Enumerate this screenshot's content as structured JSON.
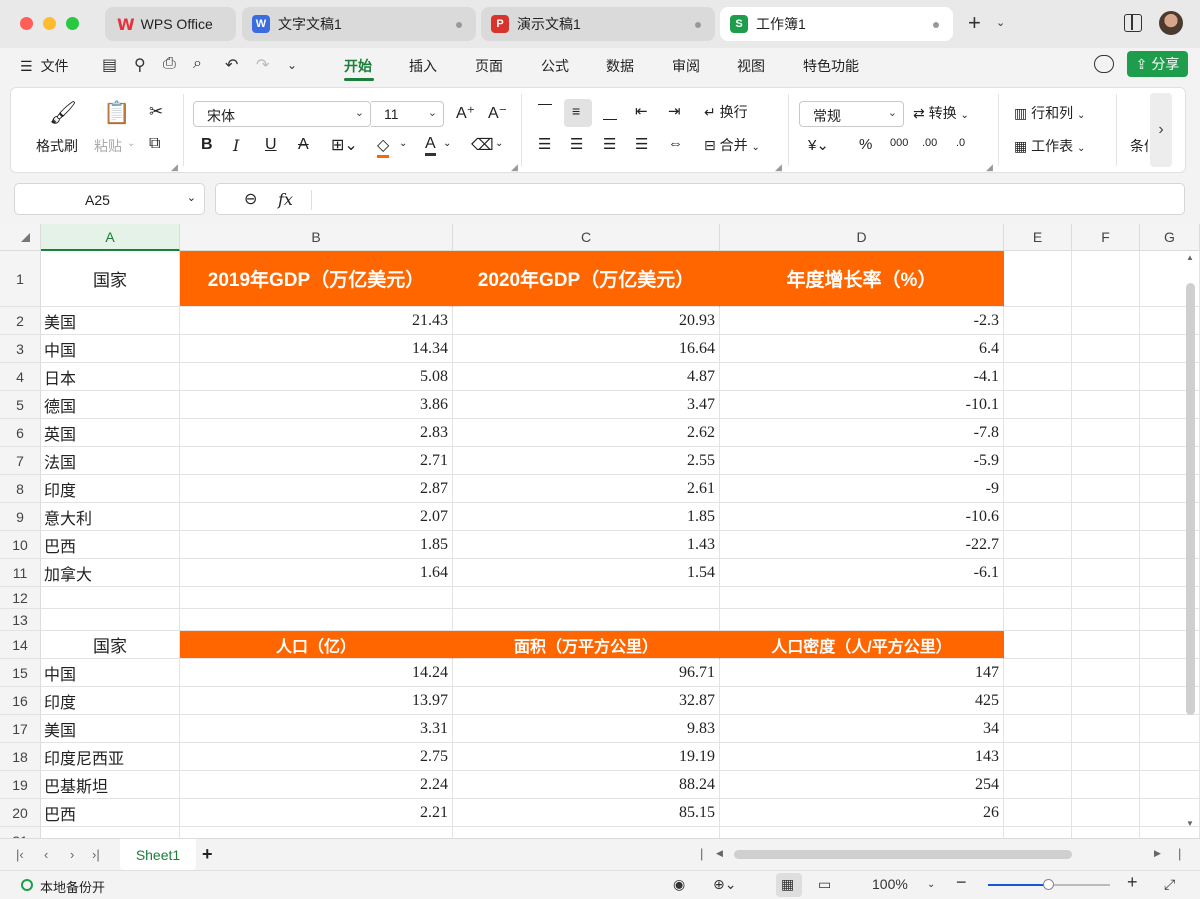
{
  "titlebar": {
    "tabs": [
      {
        "label": "WPS Office",
        "icon": "wps-logo-icon"
      },
      {
        "label": "文字文稿1",
        "icon": "writer-icon",
        "badge": "W",
        "color": "#3b6de0"
      },
      {
        "label": "演示文稿1",
        "icon": "presentation-icon",
        "badge": "P",
        "color": "#d9332d"
      },
      {
        "label": "工作簿1",
        "icon": "spreadsheet-icon",
        "badge": "S",
        "color": "#1e9e4c"
      }
    ]
  },
  "menubar": {
    "file": "文件",
    "items": [
      "开始",
      "插入",
      "页面",
      "公式",
      "数据",
      "审阅",
      "视图",
      "特色功能"
    ],
    "active": "开始",
    "share": "分享"
  },
  "ribbon": {
    "format_painter": "格式刷",
    "paste": "粘贴",
    "font_name": "宋体",
    "font_size": "11",
    "wrap": "换行",
    "merge": "合并",
    "number_format": "常规",
    "convert": "转换",
    "rows_cols": "行和列",
    "worksheet": "工作表",
    "cond": "条件"
  },
  "formula": {
    "cell_ref": "A25",
    "fx": "fx",
    "content": ""
  },
  "grid": {
    "columns": [
      "A",
      "B",
      "C",
      "D",
      "E",
      "F",
      "G"
    ],
    "selected_column": "A",
    "table1": {
      "headers": [
        "国家",
        "2019年GDP（万亿美元）",
        "2020年GDP（万亿美元）",
        "年度增长率（%）"
      ],
      "rows": [
        [
          "美国",
          "21.43",
          "20.93",
          "-2.3"
        ],
        [
          "中国",
          "14.34",
          "16.64",
          "6.4"
        ],
        [
          "日本",
          "5.08",
          "4.87",
          "-4.1"
        ],
        [
          "德国",
          "3.86",
          "3.47",
          "-10.1"
        ],
        [
          "英国",
          "2.83",
          "2.62",
          "-7.8"
        ],
        [
          "法国",
          "2.71",
          "2.55",
          "-5.9"
        ],
        [
          "印度",
          "2.87",
          "2.61",
          "-9"
        ],
        [
          "意大利",
          "2.07",
          "1.85",
          "-10.6"
        ],
        [
          "巴西",
          "1.85",
          "1.43",
          "-22.7"
        ],
        [
          "加拿大",
          "1.64",
          "1.54",
          "-6.1"
        ]
      ]
    },
    "table2": {
      "headers": [
        "国家",
        "人口（亿）",
        "面积（万平方公里）",
        "人口密度（人/平方公里）"
      ],
      "rows": [
        [
          "中国",
          "14.24",
          "96.71",
          "147"
        ],
        [
          "印度",
          "13.97",
          "32.87",
          "425"
        ],
        [
          "美国",
          "3.31",
          "9.83",
          "34"
        ],
        [
          "印度尼西亚",
          "2.75",
          "19.19",
          "143"
        ],
        [
          "巴基斯坦",
          "2.24",
          "88.24",
          "254"
        ],
        [
          "巴西",
          "2.21",
          "85.15",
          "26"
        ]
      ]
    },
    "header_color": "#ff6600"
  },
  "sheets": {
    "tabs": [
      "Sheet1"
    ],
    "active": "Sheet1"
  },
  "status": {
    "backup": "本地备份开",
    "zoom": "100%"
  }
}
